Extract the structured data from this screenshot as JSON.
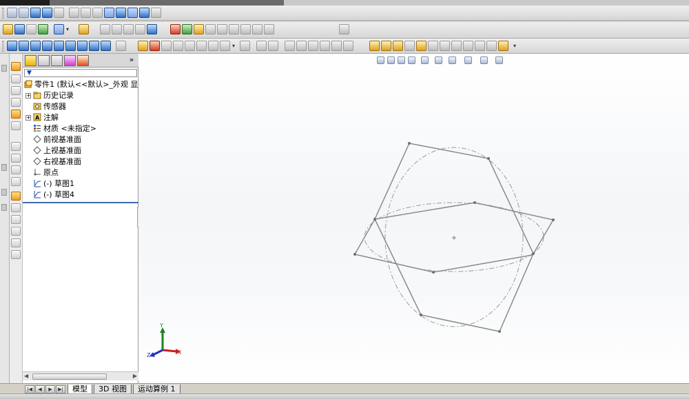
{
  "tree": {
    "root": "零件1 (默认<<默认>_外观 显",
    "items": [
      {
        "label": "历史记录",
        "icon": "history-folder-icon",
        "expandable": true
      },
      {
        "label": "传感器",
        "icon": "sensor-icon",
        "expandable": false
      },
      {
        "label": "注解",
        "icon": "annotation-icon",
        "expandable": true
      },
      {
        "label": "材质 <未指定>",
        "icon": "material-icon",
        "expandable": false
      },
      {
        "label": "前视基准面",
        "icon": "plane-icon",
        "expandable": false
      },
      {
        "label": "上视基准面",
        "icon": "plane-icon",
        "expandable": false
      },
      {
        "label": "右视基准面",
        "icon": "plane-icon",
        "expandable": false
      },
      {
        "label": "原点",
        "icon": "origin-icon",
        "expandable": false
      },
      {
        "label": "(-) 草图1",
        "icon": "sketch-icon",
        "expandable": false
      },
      {
        "label": "(-) 草图4",
        "icon": "sketch-icon",
        "expandable": false
      }
    ]
  },
  "tabs": {
    "model": "模型",
    "view3d": "3D 视图",
    "motion": "运动算例 1"
  },
  "triad": {
    "x": "X",
    "y": "Y",
    "z": "Z"
  },
  "fm_expand": "»",
  "colors": {
    "sketch_line": "#8a8a8a",
    "accent_blue": "#3d6ab0",
    "tab_active": "#f2b400"
  }
}
